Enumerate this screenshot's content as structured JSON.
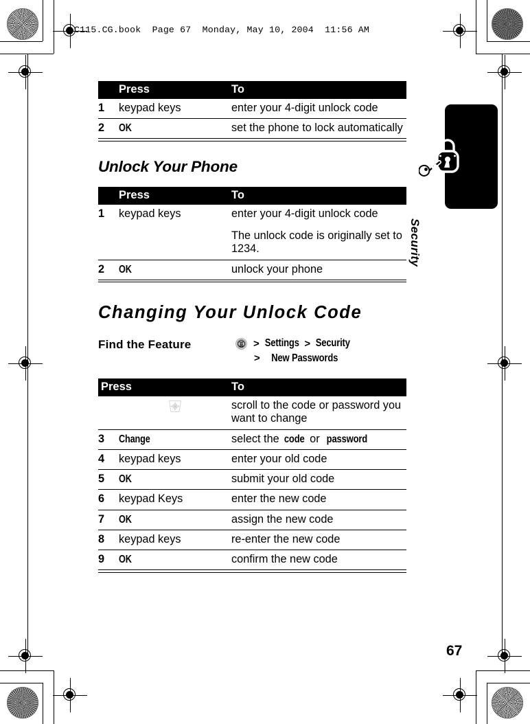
{
  "page": {
    "running_header": "C115.CG.book  Page 67  Monday, May 10, 2004  11:56 AM",
    "folio": "67"
  },
  "chapter_tab": {
    "label": "Security",
    "icon": "padlock-key-icon",
    "tab_color": "#000000"
  },
  "tables": {
    "lock_phone": {
      "headers": {
        "num": "",
        "press": "Press",
        "to": "To"
      },
      "rows": [
        {
          "num": "1",
          "press": "keypad keys",
          "press_style": "plain",
          "to": "enter your 4-digit unlock code"
        },
        {
          "num": "2",
          "press": "OK",
          "press_style": "ui",
          "to": "set the phone to lock automatically"
        }
      ]
    },
    "unlock_phone": {
      "headers": {
        "num": "",
        "press": "Press",
        "to": "To"
      },
      "rows": [
        {
          "num": "1",
          "press": "keypad keys",
          "press_style": "plain",
          "to": "enter your 4-digit unlock code",
          "note": "The unlock code is originally set to 1234."
        },
        {
          "num": "2",
          "press": "OK",
          "press_style": "ui",
          "to": "unlock your phone"
        }
      ]
    },
    "change_unlock_code": {
      "headers": {
        "num": "",
        "press": "Press",
        "to": "To"
      },
      "rows": [
        {
          "num": "",
          "press": "",
          "press_style": "nav-key-icon",
          "to": "scroll to the code or password you want to change"
        },
        {
          "num": "3",
          "press": "Change",
          "press_style": "ui",
          "to_prefix": "select the ",
          "to_em1": "code",
          "to_mid": " or ",
          "to_em2": "password"
        },
        {
          "num": "4",
          "press": "keypad keys",
          "press_style": "plain",
          "to": "enter your old code"
        },
        {
          "num": "5",
          "press": "OK",
          "press_style": "ui",
          "to": "submit your old code"
        },
        {
          "num": "6",
          "press": "keypad Keys",
          "press_style": "plain",
          "to": "enter the new code"
        },
        {
          "num": "7",
          "press": "OK",
          "press_style": "ui",
          "to": "assign the new code"
        },
        {
          "num": "8",
          "press": "keypad keys",
          "press_style": "plain",
          "to": "re-enter the new code"
        },
        {
          "num": "9",
          "press": "OK",
          "press_style": "ui",
          "to": "confirm the new code"
        }
      ]
    }
  },
  "sections": {
    "unlock_your_phone": "Unlock Your Phone",
    "changing_your_unlock_code": "Changing Your Unlock Code"
  },
  "find_the_feature": {
    "label": "Find the Feature",
    "menu_icon": "menu-key-icon",
    "gt": ">",
    "item1": "Settings",
    "item2": "Security",
    "item3": "New Passwords"
  }
}
